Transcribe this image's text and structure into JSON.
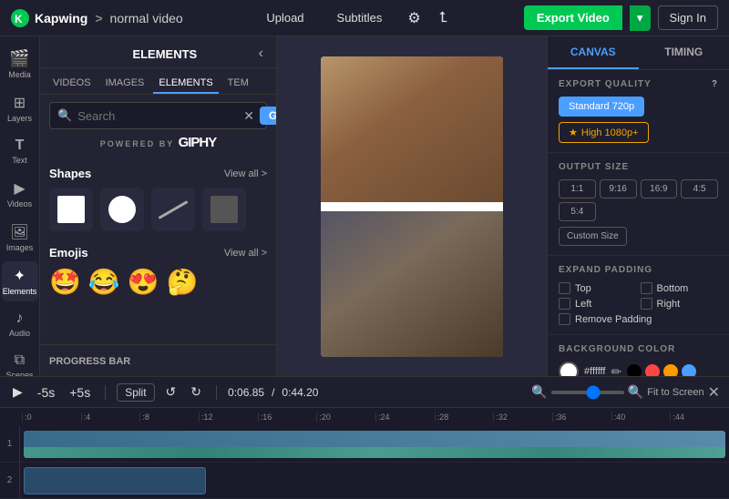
{
  "header": {
    "app_name": "Kapwing",
    "breadcrumb_separator": ">",
    "project_name": "normal video",
    "upload_label": "Upload",
    "subtitles_label": "Subtitles",
    "export_label": "Export Video",
    "sign_in_label": "Sign In"
  },
  "sidebar_icons": [
    {
      "id": "media",
      "label": "Media",
      "icon": "🎬"
    },
    {
      "id": "layers",
      "label": "Layers",
      "icon": "⊞"
    },
    {
      "id": "text",
      "label": "Text",
      "icon": "T"
    },
    {
      "id": "videos",
      "label": "Videos",
      "icon": "▶"
    },
    {
      "id": "images",
      "label": "Images",
      "icon": "🖼"
    },
    {
      "id": "elements",
      "label": "Elements",
      "icon": "✦"
    },
    {
      "id": "audio",
      "label": "Audio",
      "icon": "♪"
    },
    {
      "id": "scenes",
      "label": "Scenes",
      "icon": "⧉"
    }
  ],
  "elements_panel": {
    "title": "ELEMENTS",
    "tabs": [
      "VIDEOS",
      "IMAGES",
      "ELEMENTS",
      "TEM"
    ],
    "active_tab": "ELEMENTS",
    "search_placeholder": "Search",
    "search_go_label": "Go",
    "giphy_powered_by": "POWERED BY",
    "giphy_label": "GIPHY",
    "shapes_title": "Shapes",
    "shapes_view_all": "View all >",
    "emojis_title": "Emojis",
    "emojis_view_all": "View all >",
    "emojis": [
      "🤩",
      "😂",
      "😍",
      "🤔"
    ],
    "progress_bar_label": "PROGRESS BAR"
  },
  "right_panel": {
    "tabs": [
      "CANVAS",
      "TIMING"
    ],
    "active_tab": "CANVAS",
    "export_quality_title": "EXPORT QUALITY",
    "quality_options": [
      {
        "label": "Standard 720p",
        "active": true
      },
      {
        "label": "★ High 1080p+",
        "premium": true
      }
    ],
    "output_size_title": "OUTPUT SIZE",
    "size_options": [
      "1:1",
      "9:16",
      "16:9",
      "4:5",
      "5:4"
    ],
    "custom_size_label": "Custom Size",
    "expand_padding_title": "EXPAND PADDING",
    "padding_options": [
      "Top",
      "Bottom",
      "Left",
      "Right"
    ],
    "remove_padding_label": "Remove Padding",
    "background_color_title": "BACKGROUND COLOR",
    "bg_hex_value": "#ffffff",
    "color_swatches": [
      "#000000",
      "#ff4444",
      "#ff9900",
      "#4a9eff"
    ]
  },
  "timeline": {
    "play_icon": "▶",
    "rewind_label": "-5s",
    "forward_label": "+5s",
    "split_label": "Split",
    "current_time": "0:06.85",
    "total_time": "0:44.20",
    "fit_screen_label": "Fit to Screen",
    "ruler_marks": [
      ":0",
      ":4",
      ":8",
      ":12",
      ":16",
      ":20",
      ":24",
      ":28",
      ":32",
      ":36",
      ":40",
      ":44"
    ],
    "tracks": [
      {
        "id": "1",
        "label": "1"
      },
      {
        "id": "2",
        "label": "2"
      }
    ]
  }
}
